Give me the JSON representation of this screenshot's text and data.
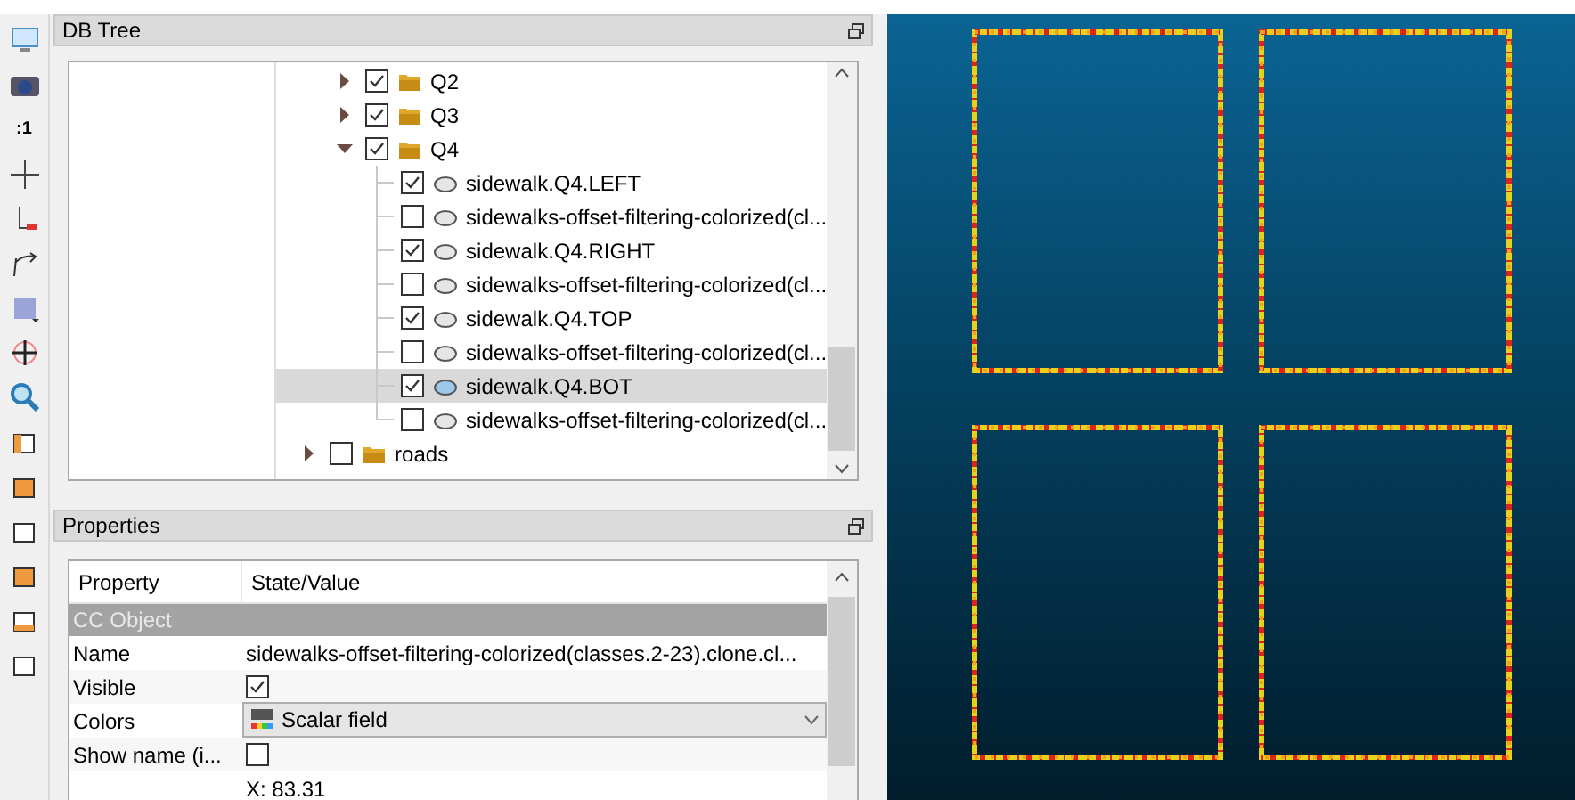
{
  "toolbar": {
    "zoom_label": ":1"
  },
  "db_tree": {
    "title": "DB Tree",
    "items": [
      {
        "children": [
          {
            "label": "Q2",
            "kind": "folder",
            "checked": true,
            "expanded": false,
            "selected": false
          },
          {
            "label": "Q3",
            "kind": "folder",
            "checked": true,
            "expanded": false,
            "selected": false
          },
          {
            "label": "Q4",
            "kind": "folder",
            "checked": true,
            "expanded": true,
            "selected": false,
            "children": [
              {
                "label": "sidewalk.Q4.LEFT",
                "kind": "cloud",
                "checked": true,
                "selected": false
              },
              {
                "label": "sidewalks-offset-filtering-colorized(cl...",
                "kind": "cloud",
                "checked": false,
                "selected": false
              },
              {
                "label": "sidewalk.Q4.RIGHT",
                "kind": "cloud",
                "checked": true,
                "selected": false
              },
              {
                "label": "sidewalks-offset-filtering-colorized(cl...",
                "kind": "cloud",
                "checked": false,
                "selected": false
              },
              {
                "label": "sidewalk.Q4.TOP",
                "kind": "cloud",
                "checked": true,
                "selected": false
              },
              {
                "label": "sidewalks-offset-filtering-colorized(cl...",
                "kind": "cloud",
                "checked": false,
                "selected": false
              },
              {
                "label": "sidewalk.Q4.BOT",
                "kind": "cloud",
                "checked": true,
                "selected": true
              },
              {
                "label": "sidewalks-offset-filtering-colorized(cl...",
                "kind": "cloud",
                "checked": false,
                "selected": false
              }
            ]
          }
        ]
      },
      {
        "label": "roads",
        "kind": "folder",
        "checked": false,
        "expanded": false,
        "selected": false
      }
    ]
  },
  "properties": {
    "title": "Properties",
    "columns": [
      "Property",
      "State/Value"
    ],
    "section": "CC Object",
    "rows": [
      {
        "kind": "text",
        "property": "Name",
        "value": "sidewalks-offset-filtering-colorized(classes.2-23).clone.cl..."
      },
      {
        "kind": "checkbox",
        "property": "Visible",
        "checked": true
      },
      {
        "kind": "combo",
        "property": "Colors",
        "value": "Scalar field"
      },
      {
        "kind": "checkbox",
        "property": "Show name (i...",
        "checked": false
      },
      {
        "kind": "text",
        "property": "",
        "value": "X: 83.31"
      }
    ]
  }
}
